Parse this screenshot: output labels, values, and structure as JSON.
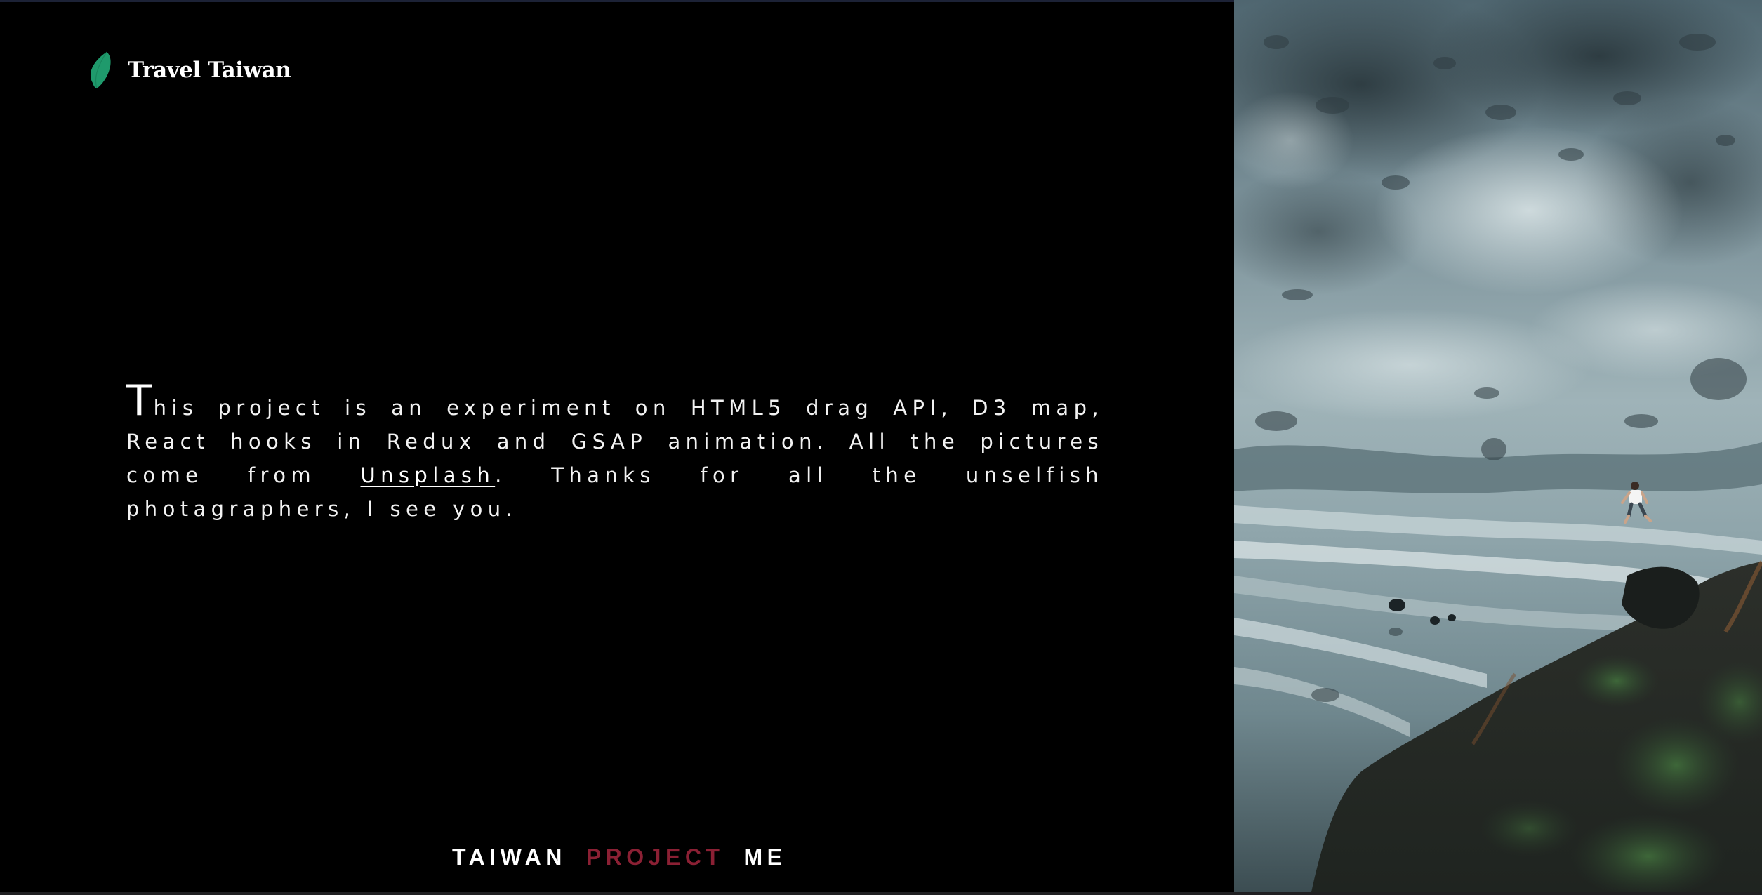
{
  "brand": {
    "name": "Travel Taiwan",
    "icon": "taiwan-island-icon",
    "icon_color": "#1f9a6c"
  },
  "intro": {
    "dropcap": "T",
    "text_before_link": "his project is an experiment on HTML5 drag API, D3 map, React hooks in Redux and GSAP animation. All the pictures come from ",
    "link_text": "Unsplash",
    "text_after_link": ". Thanks for all the unselfish photagraphers, I see you."
  },
  "nav": {
    "items": [
      {
        "label": "TAIWAN",
        "active": false
      },
      {
        "label": "PROJECT",
        "active": true
      },
      {
        "label": "ME",
        "active": false
      }
    ],
    "active_color": "#8b2034"
  },
  "photo": {
    "description": "aerial-coastline-photo"
  },
  "colors": {
    "background": "#000000",
    "text": "#ffffff",
    "accent": "#8b2034"
  }
}
